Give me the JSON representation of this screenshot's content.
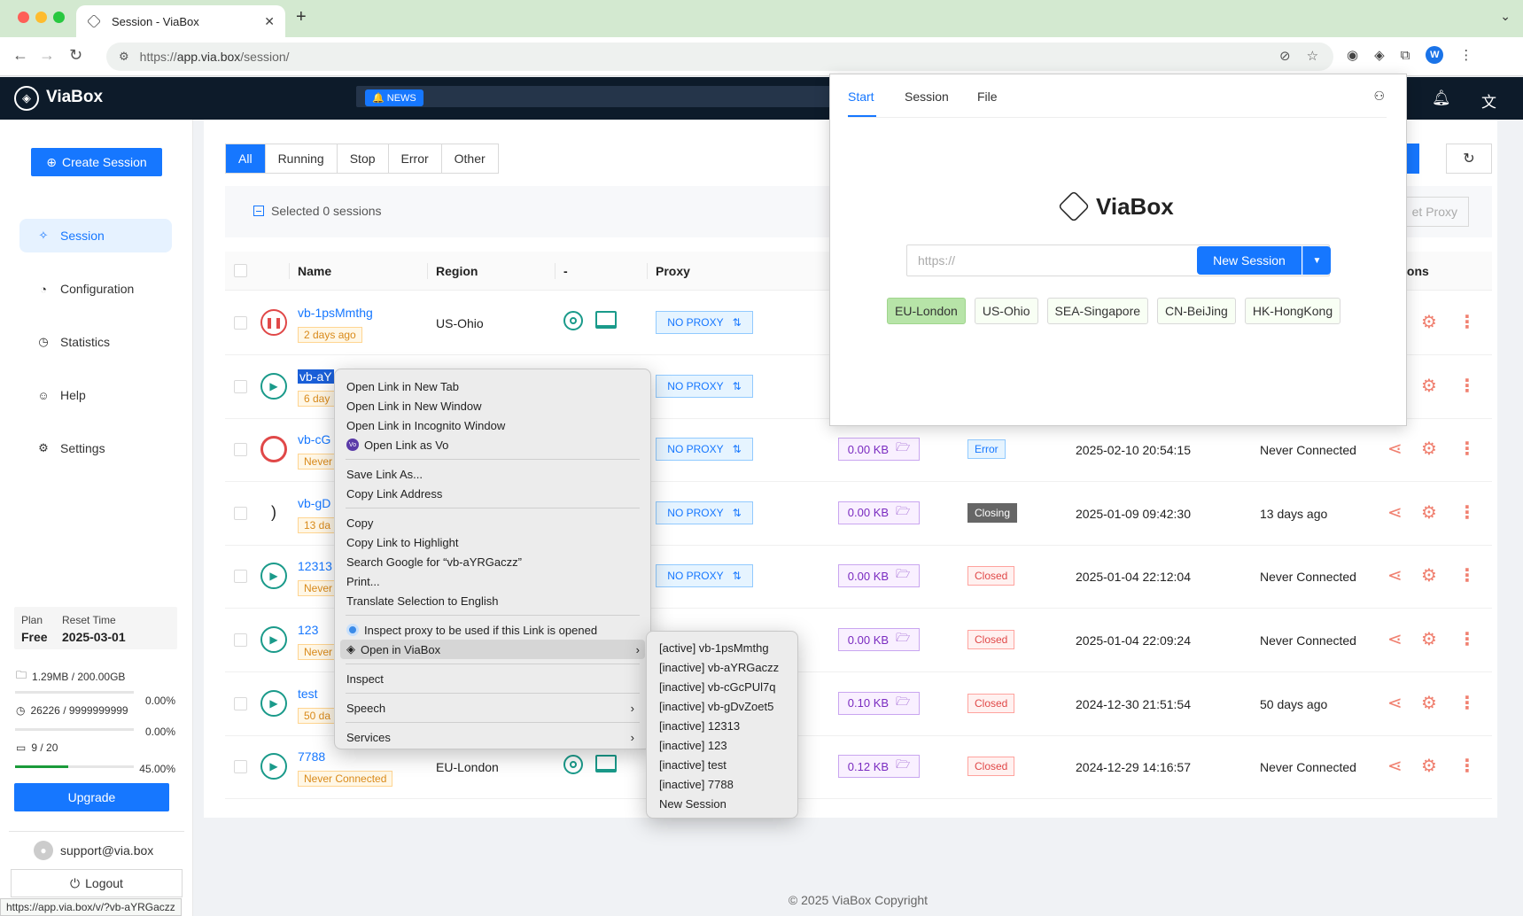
{
  "browser": {
    "tab_title": "Session - ViaBox",
    "url_prefix": "https://",
    "url_host": "app.via.box",
    "url_path": "/session/",
    "profile_initial": "W",
    "status_url": "https://app.via.box/v/?vb-aYRGaczz"
  },
  "header": {
    "brand": "ViaBox",
    "news_label": "NEWS"
  },
  "sidebar": {
    "create_button": "Create Session",
    "items": [
      {
        "label": "Session",
        "icon": "rocket-icon",
        "active": true
      },
      {
        "label": "Configuration",
        "icon": "config-icon",
        "active": false
      },
      {
        "label": "Statistics",
        "icon": "chart-icon",
        "active": false
      },
      {
        "label": "Help",
        "icon": "help-icon",
        "active": false
      },
      {
        "label": "Settings",
        "icon": "gear-icon",
        "active": false
      }
    ],
    "plan_label": "Plan",
    "plan_value": "Free",
    "reset_label": "Reset Time",
    "reset_value": "2025-03-01",
    "storage_text": "1.29MB / 200.00GB",
    "storage_pct": "0.00%",
    "storage_fraction": 0.0,
    "minutes_text": "26226 / 9999999999",
    "minutes_pct": "0.00%",
    "minutes_fraction": 0.0,
    "sessions_text": "9 / 20",
    "sessions_pct": "45.00%",
    "sessions_fraction": 0.45,
    "upgrade_button": "Upgrade",
    "user_email": "support@via.box",
    "logout_button": "Logout"
  },
  "main": {
    "filters": [
      "All",
      "Running",
      "Stop",
      "Error",
      "Other"
    ],
    "active_filter": "All",
    "selected_text": "Selected 0 sessions",
    "set_proxy_button": "et Proxy",
    "columns": {
      "name": "Name",
      "region": "Region",
      "dash": "-",
      "proxy": "Proxy",
      "actions": "ions"
    },
    "rows": [
      {
        "name": "vb-1psMmthg",
        "tag": "2 days ago",
        "region": "US-Ohio",
        "status": "pause",
        "proxy": "NO PROXY",
        "size": "",
        "state": "",
        "state_class": "",
        "created": "",
        "last": ""
      },
      {
        "name": "vb-aY",
        "tag": "6 day",
        "region": "",
        "status": "play",
        "proxy": "NO PROXY",
        "size": "",
        "state": "",
        "state_class": "",
        "created": "",
        "last": ""
      },
      {
        "name": "vb-cG",
        "tag": "Never",
        "region": "",
        "status": "ban",
        "proxy": "NO PROXY",
        "size": "0.00 KB",
        "state": "Error",
        "state_class": "error",
        "created": "2025-02-10 20:54:15",
        "last": "Never Connected"
      },
      {
        "name": "vb-gD",
        "tag": "13 da",
        "region": "",
        "status": "spin",
        "proxy": "NO PROXY",
        "size": "0.00 KB",
        "state": "Closing",
        "state_class": "closing",
        "created": "2025-01-09 09:42:30",
        "last": "13 days ago"
      },
      {
        "name": "12313",
        "tag": "Never",
        "region": "",
        "status": "play",
        "proxy": "NO PROXY",
        "size": "0.00 KB",
        "state": "Closed",
        "state_class": "closed",
        "created": "2025-01-04 22:12:04",
        "last": "Never Connected"
      },
      {
        "name": "123",
        "tag": "Never",
        "region": "",
        "status": "play",
        "proxy": "",
        "size": "0.00 KB",
        "state": "Closed",
        "state_class": "closed",
        "created": "2025-01-04 22:09:24",
        "last": "Never Connected"
      },
      {
        "name": "test",
        "tag": "50 da",
        "region": "",
        "status": "play",
        "proxy": "",
        "size": "0.10 KB",
        "state": "Closed",
        "state_class": "closed",
        "created": "2024-12-30 21:51:54",
        "last": "50 days ago"
      },
      {
        "name": "7788",
        "tag": "Never Connected",
        "region": "EU-London",
        "status": "play",
        "proxy": "",
        "size": "0.12 KB",
        "state": "Closed",
        "state_class": "closed",
        "created": "2024-12-29 14:16:57",
        "last": "Never Connected"
      }
    ],
    "footer": "© 2025 ViaBox Copyright"
  },
  "context_menu": {
    "items": [
      "Open Link in New Tab",
      "Open Link in New Window",
      "Open Link in Incognito Window",
      "Open Link as Vo",
      "Save Link As...",
      "Copy Link Address",
      "Copy",
      "Copy Link to Highlight",
      "Search Google for “vb-aYRGaczz”",
      "Print...",
      "Translate Selection to English",
      "Inspect proxy to be used if this Link is opened",
      "Open in ViaBox",
      "Inspect",
      "Speech",
      "Services"
    ],
    "vo_badge": "Vo"
  },
  "submenu": {
    "items": [
      "[active] vb-1psMmthg",
      "[inactive] vb-aYRGaczz",
      "[inactive] vb-cGcPUl7q",
      "[inactive] vb-gDvZoet5",
      "[inactive] 12313",
      "[inactive] 123",
      "[inactive] test",
      "[inactive] 7788",
      "New Session"
    ]
  },
  "popup": {
    "tabs": [
      "Start",
      "Session",
      "File"
    ],
    "brand": "ViaBox",
    "url_placeholder": "https://",
    "new_session_button": "New Session",
    "regions": [
      "EU-London",
      "US-Ohio",
      "SEA-Singapore",
      "CN-BeiJing",
      "HK-HongKong"
    ],
    "selected_region": "EU-London"
  },
  "colors": {
    "primary": "#1677ff",
    "header_bg": "#0d1b2a",
    "teal": "#1a9a8a",
    "danger": "#e04848"
  }
}
